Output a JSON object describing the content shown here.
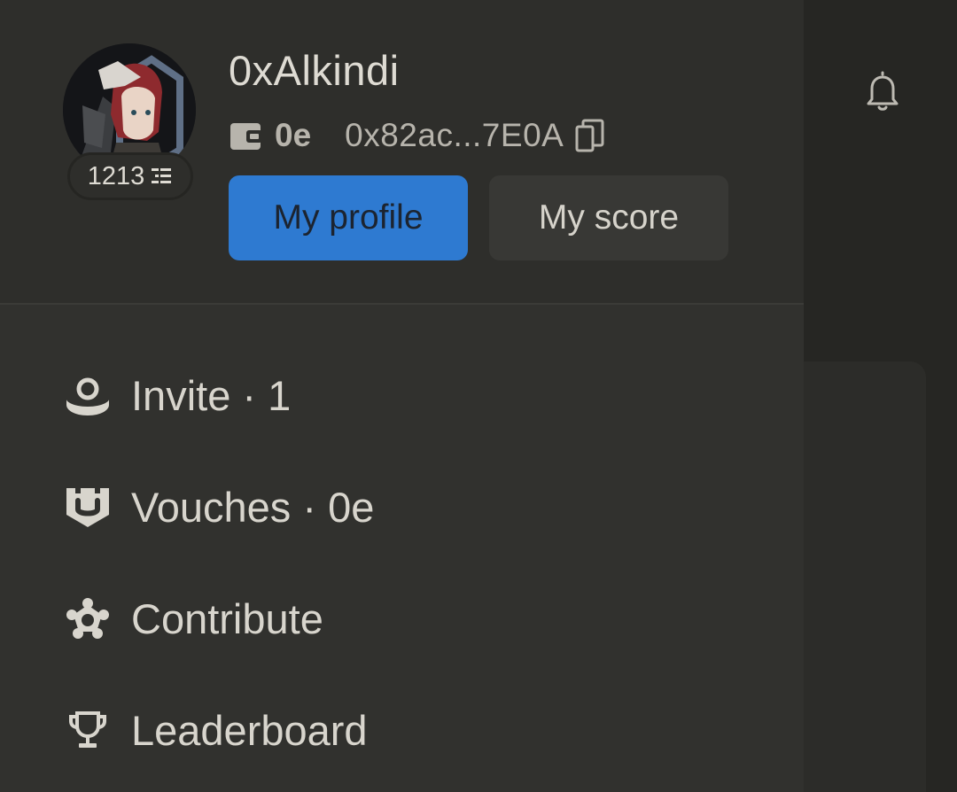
{
  "profile": {
    "username": "0xAlkindi",
    "score": "1213",
    "wallet_balance": "0e",
    "wallet_address": "0x82ac...7E0A"
  },
  "buttons": {
    "my_profile": "My profile",
    "my_score": "My score"
  },
  "menu": {
    "items": [
      {
        "label": "Invite · 1",
        "icon": "invite-icon"
      },
      {
        "label": "Vouches · 0e",
        "icon": "vouch-shield-icon"
      },
      {
        "label": "Contribute",
        "icon": "contribute-star-icon"
      },
      {
        "label": "Leaderboard",
        "icon": "trophy-icon"
      }
    ]
  },
  "colors": {
    "primary": "#2e7ad1",
    "drawer_bg": "#31312e",
    "header_bg": "#2e2e2b",
    "text": "#d8d5cd"
  }
}
